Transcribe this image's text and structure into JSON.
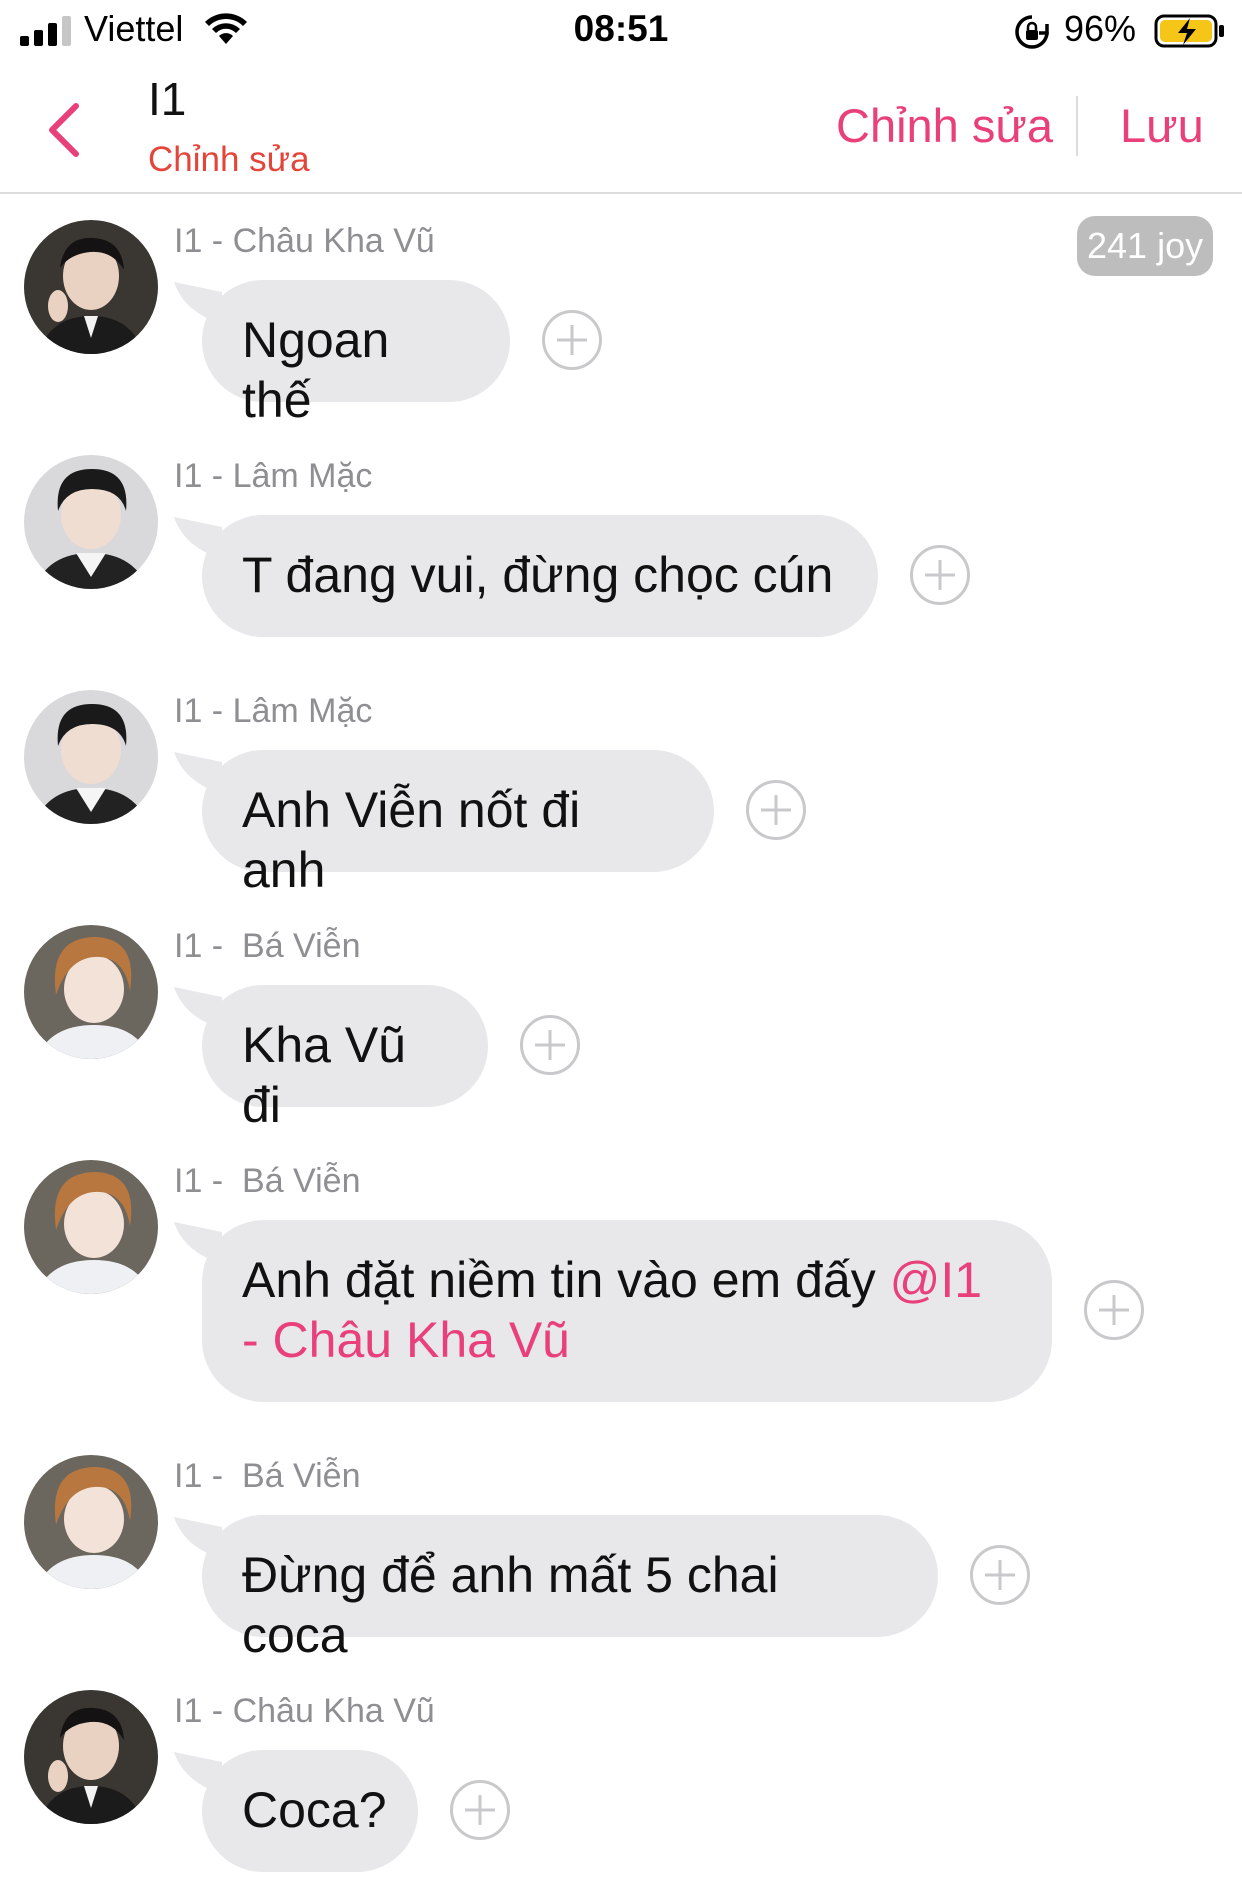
{
  "status_bar": {
    "carrier": "Viettel",
    "time": "08:51",
    "battery_percent": "96%",
    "icons": [
      "signal-icon",
      "wifi-icon",
      "rotation-lock-icon",
      "battery-charging-icon"
    ]
  },
  "nav": {
    "title": "I1",
    "subtitle": "Chỉnh sửa",
    "edit_label": "Chỉnh sửa",
    "save_label": "Lưu",
    "accent_color": "#e9407a",
    "subtitle_color": "#e4453a"
  },
  "joy_badge": "241 joy",
  "messages": [
    {
      "sender": "I1 - Châu Kha Vũ",
      "avatar": "chau-kha-vu",
      "text": "Ngoan thế",
      "mention": ""
    },
    {
      "sender": "I1 - Lâm Mặc",
      "avatar": "lam-mac",
      "text": "T đang vui, đừng chọc cún",
      "mention": ""
    },
    {
      "sender": "I1 - Lâm Mặc",
      "avatar": "lam-mac",
      "text": "Anh Viễn nốt đi anh",
      "mention": ""
    },
    {
      "sender": "I1 -  Bá Viễn",
      "avatar": "ba-vien",
      "text": "Kha Vũ đi",
      "mention": ""
    },
    {
      "sender": "I1 -  Bá Viễn",
      "avatar": "ba-vien",
      "text": "Anh đặt niềm tin vào em đấy ",
      "mention": "@I1 - Châu Kha Vũ"
    },
    {
      "sender": "I1 -  Bá Viễn",
      "avatar": "ba-vien",
      "text": "Đừng để anh mất 5 chai coca",
      "mention": ""
    },
    {
      "sender": "I1 - Châu Kha Vũ",
      "avatar": "chau-kha-vu",
      "text": "Coca?",
      "mention": ""
    }
  ]
}
